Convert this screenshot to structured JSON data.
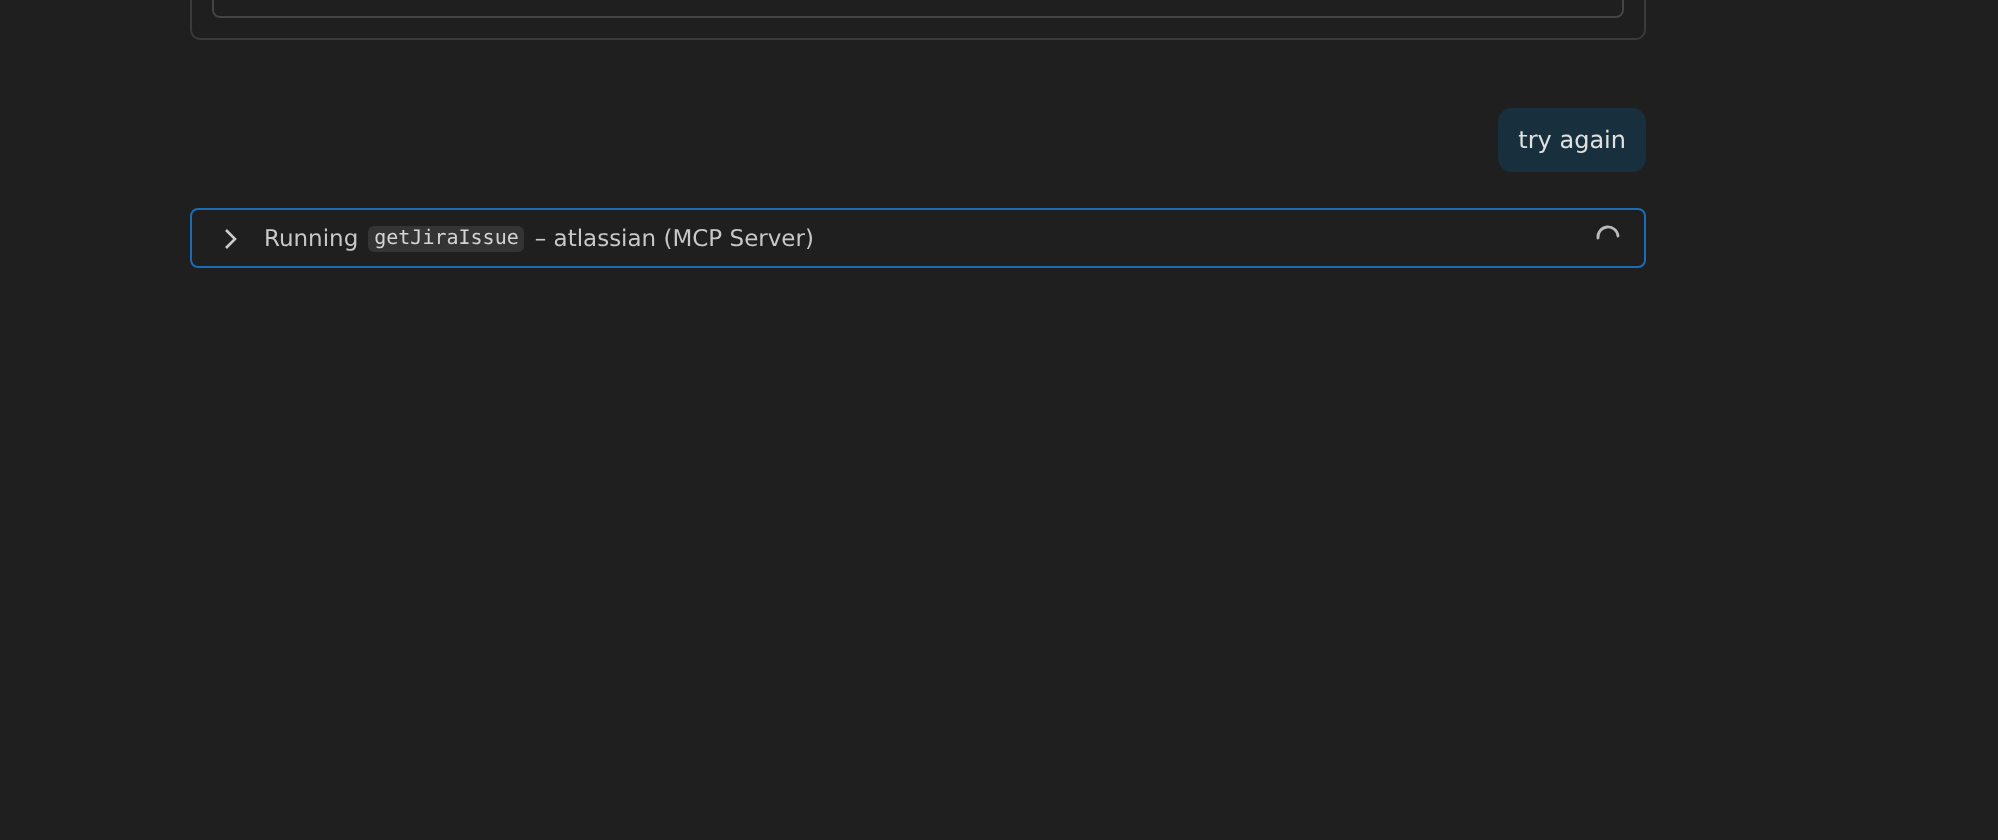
{
  "user_message": {
    "text": "try again"
  },
  "tool_call": {
    "expanded": false,
    "status": "Running",
    "tool_name": "getJiraIssue",
    "source": "– atlassian (MCP Server)"
  }
}
